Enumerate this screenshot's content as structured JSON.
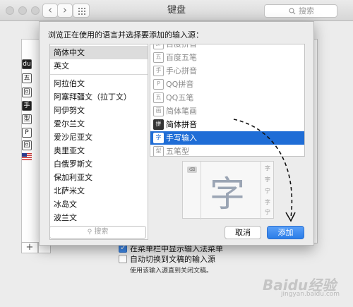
{
  "window": {
    "title": "键盘",
    "search_placeholder": "搜索",
    "back_glyph": "‹",
    "forward_glyph": "›"
  },
  "background": {
    "checkbox_menu_label": "在菜单栏中显示输入法菜单",
    "checkbox_auto_label": "自动切换到文稿的输入源",
    "hint_text": "使用该输入源直到关闭文稿。",
    "add_glyph": "+",
    "icon_glyphs": [
      "du",
      "五",
      "回",
      "手",
      "型",
      "P",
      "回"
    ]
  },
  "sheet": {
    "prompt": "浏览正在使用的语言并选择要添加的输入源：",
    "languages": [
      "简体中文",
      "英文",
      "阿拉伯文",
      "阿塞拜疆文（拉丁文）",
      "阿伊努文",
      "爱尔兰文",
      "爱沙尼亚文",
      "奥里亚文",
      "白俄罗斯文",
      "保加利亚文",
      "北萨米文",
      "冰岛文",
      "波兰文"
    ],
    "selected_language": "简体中文",
    "sources": [
      {
        "icon": "拼",
        "label": "百度拼音",
        "gray": true,
        "selected": false
      },
      {
        "icon": "五",
        "label": "百度五笔",
        "gray": true,
        "selected": false
      },
      {
        "icon": "手",
        "label": "手心拼音",
        "gray": true,
        "selected": false
      },
      {
        "icon": "P",
        "label": "QQ拼音",
        "gray": true,
        "selected": false
      },
      {
        "icon": "五",
        "label": "QQ五笔",
        "gray": true,
        "selected": false
      },
      {
        "icon": "画",
        "label": "简体笔画",
        "gray": true,
        "selected": false
      },
      {
        "icon": "拼",
        "label": "简体拼音",
        "gray": false,
        "selected": false
      },
      {
        "icon": "字",
        "label": "手写输入",
        "gray": false,
        "selected": true
      },
      {
        "icon": "型",
        "label": "五笔型",
        "gray": true,
        "selected": false
      }
    ],
    "preview": {
      "handwritten_char": "字",
      "candidates": [
        "字",
        "宇",
        "宁",
        "字",
        "宁"
      ],
      "backspace_label": "⌫"
    },
    "search_placeholder": "搜索",
    "cancel_label": "取消",
    "add_label": "添加"
  },
  "watermark": {
    "text": "Baidu经验",
    "sub": "jingyan.baidu.com"
  }
}
